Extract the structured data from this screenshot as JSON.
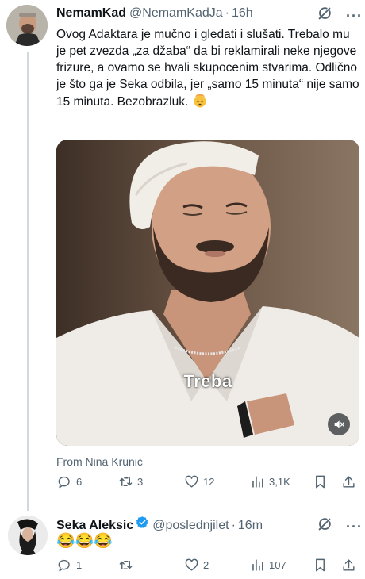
{
  "tweet1": {
    "display_name": "NemamKad",
    "handle": "@NemamKadJa",
    "separator": "·",
    "time": "16h",
    "text": "Ovog Adaktara je mučno i gledati i slušati. Trebalo mu je pet zvezda „za džaba“ da bi reklamirali neke njegove frizure, a ovamo se hvali skupocenim stvarima. Odlično je što ga je Seka odbila, jer „samo 15 minuta“ nije samo 15 minuta. Bezobrazluk.",
    "emoji": "exploding-head",
    "video_caption": "Treba",
    "from_label": "From Nina Krunić",
    "actions": {
      "replies": "6",
      "reposts": "3",
      "likes": "12",
      "views": "3,1K"
    }
  },
  "tweet2": {
    "display_name": "Seka Aleksic",
    "handle": "@poslednjilet",
    "separator": "·",
    "time": "16m",
    "verified": true,
    "emoji_text": "😂😂😂",
    "actions": {
      "replies": "1",
      "reposts": "",
      "likes": "2",
      "views": "107"
    }
  },
  "icons": {
    "more": "···",
    "grok": "grok-icon",
    "reply": "reply-icon",
    "repost": "repost-icon",
    "like": "heart-icon",
    "views": "views-icon",
    "bookmark": "bookmark-icon",
    "share": "share-icon",
    "mute": "mute-icon"
  },
  "colors": {
    "text_primary": "#0f1419",
    "text_secondary": "#536471",
    "verified_blue": "#1d9bf0",
    "thread_line": "#cfd9de"
  }
}
